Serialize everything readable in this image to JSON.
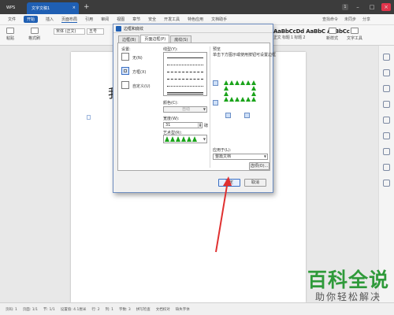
{
  "titlebar": {
    "wps_tab": "WPS",
    "doc_tab": "文字文稿1",
    "new_tab": "+",
    "badge": "1",
    "close": "×"
  },
  "menubar": {
    "items": [
      "文件",
      "开始",
      "插入",
      "页面布局",
      "引用",
      "审阅",
      "视图",
      "章节",
      "安全",
      "开发工具",
      "特色应用",
      "文档助手"
    ],
    "search": "查找命令",
    "cloud": "未同步",
    "share": "分享"
  },
  "toolbar": {
    "paste": "粘贴",
    "format_painter": "格式刷",
    "font": "宋体 (正文)",
    "size": "五号",
    "styles_sample": "AaBbCcDd AaBbC AaBbCc",
    "styles_caption": "正文  标题 1  标题 2",
    "new_style": "新样式",
    "text_tools": "文字工具",
    "find_replace": "查找替换",
    "select": "选择"
  },
  "page": {
    "char": "我"
  },
  "statusbar": {
    "items": [
      "页码: 1",
      "页面: 1/1",
      "节: 1/1",
      "设置值: 4.1厘米",
      "行: 2",
      "列: 1",
      "字数: 3",
      "拼写检查",
      "文档校对",
      "缺失字体"
    ]
  },
  "dialog": {
    "title": "边框和底纹",
    "tabs": [
      "边框(B)",
      "页面边框(P)",
      "底纹(S)"
    ],
    "selected_tab": 1,
    "setting_label": "设置:",
    "settings": [
      "无(N)",
      "方框(X)",
      "自定义(U)"
    ],
    "linetype_label": "线型(Y):",
    "color_label": "颜色(C):",
    "color_value": "自动",
    "width_label": "宽度(W):",
    "width_value": "31",
    "width_unit": "磅",
    "art_label": "艺术型(R):",
    "preview_label": "预览",
    "preview_hint": "单击下方图示或使用按钮可设置边框",
    "apply_label": "应用于(L):",
    "apply_value": "整篇文档",
    "options_button": "选项(O)...",
    "ok_button": "确定",
    "cancel_button": "取消"
  },
  "watermark": {
    "title": "百科全说",
    "subtitle": "助你轻松解决"
  },
  "colors": {
    "accent": "#1f5fb3",
    "tree_green": "#1aa31a",
    "arrow_red": "#e03030",
    "watermark_green": "#2f9a3a"
  }
}
